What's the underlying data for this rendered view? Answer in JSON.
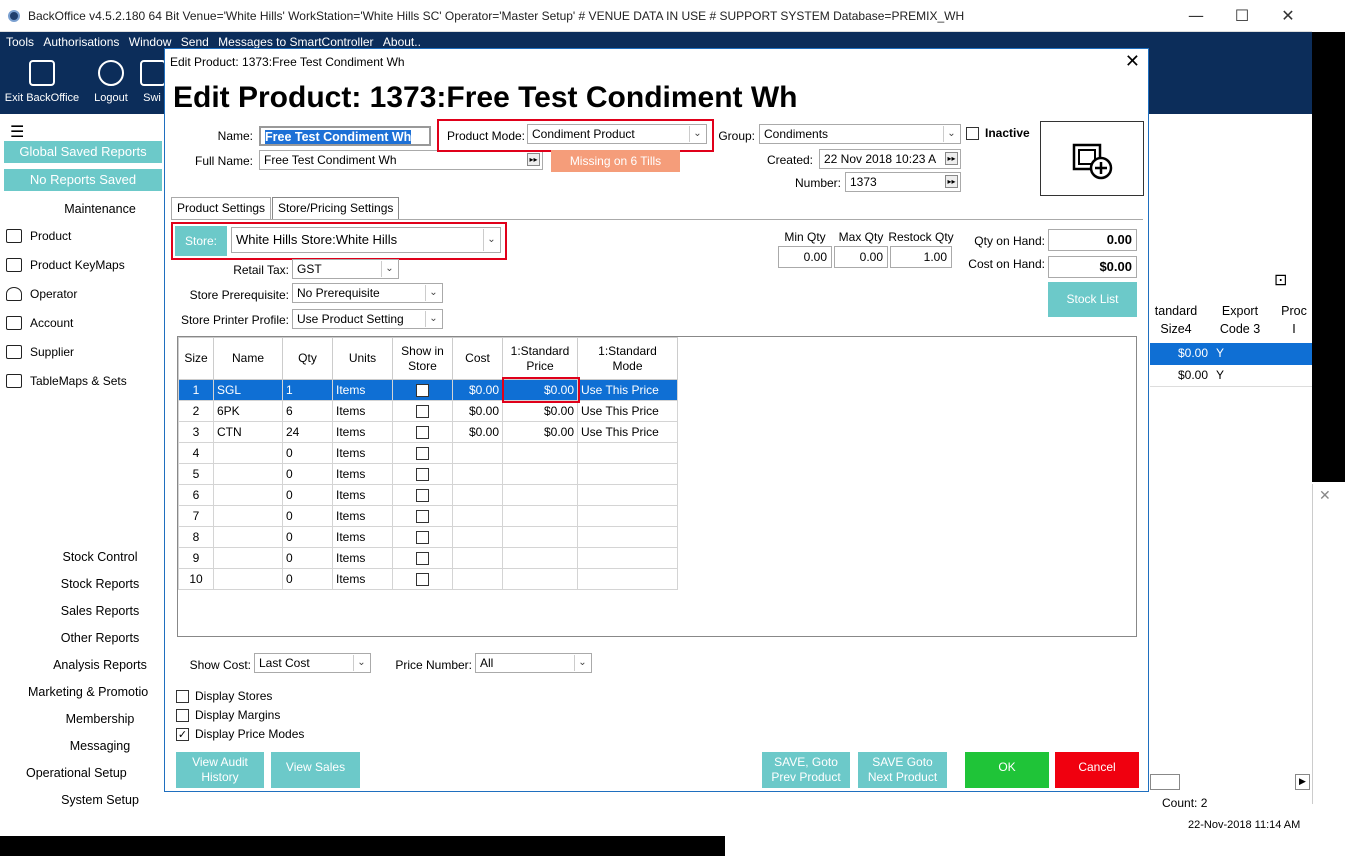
{
  "window": {
    "title": "BackOffice v4.5.2.180 64 Bit Venue='White Hills' WorkStation='White Hills SC'  Operator='Master Setup'  # VENUE DATA IN USE # SUPPORT SYSTEM Database=PREMIX_WH"
  },
  "menu": [
    "Tools",
    "Authorisations",
    "Window",
    "Send",
    "Messages to SmartController",
    "About.."
  ],
  "toolbar": {
    "exit": "Exit BackOffice",
    "logout": "Logout",
    "switch": "Swi"
  },
  "left": {
    "global_reports": "Global Saved Reports",
    "no_reports": "No Reports Saved",
    "maintenance": "Maintenance",
    "nav": [
      "Product",
      "Product KeyMaps",
      "Operator",
      "Account",
      "Supplier",
      "TableMaps & Sets"
    ],
    "sections": [
      "Stock Control",
      "Stock Reports",
      "Sales Reports",
      "Other Reports",
      "Analysis Reports",
      "Marketing & Promotio",
      "Membership",
      "Messaging",
      "Operational Setup",
      "System Setup"
    ]
  },
  "background": {
    "col1": "tandard\nSize4",
    "col2": "Export\nCode 3",
    "col3": "Proc\nI",
    "row1": [
      "$0.00",
      "Y"
    ],
    "row2": [
      "$0.00",
      "Y"
    ],
    "count": "Count: 2",
    "datetime": "22-Nov-2018  11:14 AM"
  },
  "dialog": {
    "title": "Edit Product: 1373:Free Test Condiment Wh",
    "heading": "Edit Product: 1373:Free Test Condiment Wh",
    "name_label": "Name:",
    "name_value": "Free Test Condiment Wh",
    "fullname_label": "Full Name:",
    "fullname_value": "Free Test Condiment Wh",
    "mode_label": "Product Mode:",
    "mode_value": "Condiment Product",
    "missing": "Missing on 6 Tills",
    "group_label": "Group:",
    "group_value": "Condiments",
    "inactive_label": "Inactive",
    "created_label": "Created:",
    "created_value": "22 Nov 2018 10:23 A",
    "number_label": "Number:",
    "number_value": "1373",
    "tabs": [
      "Product Settings",
      "Store/Pricing Settings"
    ],
    "store_btn": "Store:",
    "store_value": "White Hills Store:White Hills",
    "retail_tax_label": "Retail Tax:",
    "retail_tax_value": "GST",
    "prereq_label": "Store Prerequisite:",
    "prereq_value": "No Prerequisite",
    "printer_label": "Store Printer Profile:",
    "printer_value": "Use Product Setting",
    "min_qty_label": "Min Qty",
    "min_qty": "0.00",
    "max_qty_label": "Max Qty",
    "max_qty": "0.00",
    "restock_label": "Restock Qty",
    "restock": "1.00",
    "qty_hand_label": "Qty on Hand:",
    "qty_hand": "0.00",
    "cost_hand_label": "Cost on Hand:",
    "cost_hand": "$0.00",
    "stock_list": "Stock List",
    "grid": {
      "headers": [
        "Size",
        "Name",
        "Qty",
        "Units",
        "Show in\nStore",
        "Cost",
        "1:Standard\nPrice",
        "1:Standard\nMode"
      ],
      "rows": [
        {
          "size": "1",
          "name": "SGL",
          "qty": "1",
          "units": "Items",
          "show": true,
          "cost": "$0.00",
          "price": "$0.00",
          "mode": "Use This Price"
        },
        {
          "size": "2",
          "name": "6PK",
          "qty": "6",
          "units": "Items",
          "show": false,
          "cost": "$0.00",
          "price": "$0.00",
          "mode": "Use This Price"
        },
        {
          "size": "3",
          "name": "CTN",
          "qty": "24",
          "units": "Items",
          "show": false,
          "cost": "$0.00",
          "price": "$0.00",
          "mode": "Use This Price"
        },
        {
          "size": "4",
          "name": "",
          "qty": "0",
          "units": "Items",
          "show": false,
          "cost": "",
          "price": "",
          "mode": ""
        },
        {
          "size": "5",
          "name": "",
          "qty": "0",
          "units": "Items",
          "show": false,
          "cost": "",
          "price": "",
          "mode": ""
        },
        {
          "size": "6",
          "name": "",
          "qty": "0",
          "units": "Items",
          "show": false,
          "cost": "",
          "price": "",
          "mode": ""
        },
        {
          "size": "7",
          "name": "",
          "qty": "0",
          "units": "Items",
          "show": false,
          "cost": "",
          "price": "",
          "mode": ""
        },
        {
          "size": "8",
          "name": "",
          "qty": "0",
          "units": "Items",
          "show": false,
          "cost": "",
          "price": "",
          "mode": ""
        },
        {
          "size": "9",
          "name": "",
          "qty": "0",
          "units": "Items",
          "show": false,
          "cost": "",
          "price": "",
          "mode": ""
        },
        {
          "size": "10",
          "name": "",
          "qty": "0",
          "units": "Items",
          "show": false,
          "cost": "",
          "price": "",
          "mode": ""
        }
      ]
    },
    "show_cost_label": "Show Cost:",
    "show_cost_value": "Last Cost",
    "price_number_label": "Price Number:",
    "price_number_value": "All",
    "checks": [
      {
        "label": "Display Stores",
        "checked": false
      },
      {
        "label": "Display Margins",
        "checked": false
      },
      {
        "label": "Display Price Modes",
        "checked": true
      }
    ],
    "buttons": {
      "audit": "View Audit\nHistory",
      "sales": "View Sales",
      "prev": "SAVE, Goto\nPrev Product",
      "next": "SAVE Goto\nNext Product",
      "ok": "OK",
      "cancel": "Cancel"
    }
  }
}
